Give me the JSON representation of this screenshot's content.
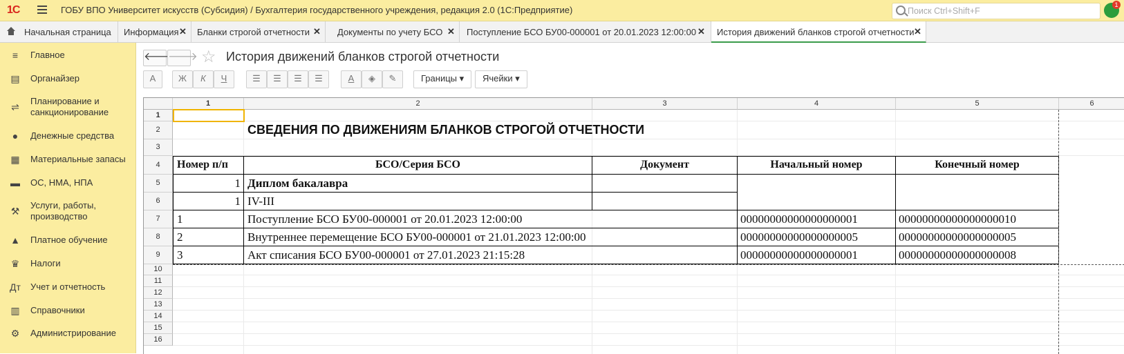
{
  "app": {
    "logo": "1С",
    "title": "ГОБУ ВПО Университет искусств (Субсидия) / Бухгалтерия государственного учреждения, редакция 2.0  (1С:Предприятие)",
    "search_placeholder": "Поиск Ctrl+Shift+F",
    "notifications": "1"
  },
  "tabs": [
    {
      "label": "Начальная страница"
    },
    {
      "label": "Информация"
    },
    {
      "label": "Бланки строгой отчетности"
    },
    {
      "label": "Документы по учету БСО"
    },
    {
      "label": "Поступление БСО БУ00-000001 от 20.01.2023 12:00:00"
    },
    {
      "label": "История движений бланков строгой отчетности"
    }
  ],
  "sidebar": {
    "items": [
      {
        "label": "Главное",
        "icon": "menu-list-icon"
      },
      {
        "label": "Органайзер",
        "icon": "organizer-icon"
      },
      {
        "label": "Планирование и",
        "label2": "санкционирование",
        "icon": "planning-icon"
      },
      {
        "label": "Денежные средства",
        "icon": "money-icon"
      },
      {
        "label": "Материальные запасы",
        "icon": "inventory-icon"
      },
      {
        "label": "ОС, НМА, НПА",
        "icon": "truck-icon"
      },
      {
        "label": "Услуги, работы,",
        "label2": "производство",
        "icon": "services-icon"
      },
      {
        "label": "Платное обучение",
        "icon": "graduation-icon"
      },
      {
        "label": "Налоги",
        "icon": "eagle-icon"
      },
      {
        "label": "Учет и отчетность",
        "icon": "accounting-icon"
      },
      {
        "label": "Справочники",
        "icon": "book-icon"
      },
      {
        "label": "Администрирование",
        "icon": "gear-icon"
      }
    ]
  },
  "page": {
    "title": "История движений бланков строгой отчетности",
    "toolbar": {
      "font_btn": "A",
      "bold": "Ж",
      "italic": "К",
      "underline": "Ч",
      "borders": "Границы",
      "cells": "Ячейки"
    }
  },
  "sheet": {
    "col_headers": [
      "1",
      "2",
      "3",
      "4",
      "5",
      "6"
    ],
    "row_headers": [
      "1",
      "2",
      "3",
      "4",
      "5",
      "6",
      "7",
      "8",
      "9",
      "10",
      "11",
      "12",
      "13",
      "14",
      "15",
      "16"
    ],
    "report_title": "СВЕДЕНИЯ ПО ДВИЖЕНИЯМ БЛАНКОВ СТРОГОЙ ОТЧЕТНОСТИ",
    "headers": {
      "num": "Номер п/п",
      "bso": "БСО/Серия БСО",
      "doc": "Документ",
      "start": "Начальный номер",
      "end": "Конечный номер"
    },
    "group": {
      "num": "1",
      "name": "Диплом бакалавра"
    },
    "series": {
      "num": "1",
      "name": "IV-III"
    },
    "rows": [
      {
        "num": "1",
        "doc": "Поступление БСО БУ00-000001 от 20.01.2023 12:00:00",
        "start": "00000000000000000001",
        "end": "00000000000000000010"
      },
      {
        "num": "2",
        "doc": "Внутреннее перемещение БСО БУ00-000001 от 21.01.2023 12:00:00",
        "start": "00000000000000000005",
        "end": "00000000000000000005"
      },
      {
        "num": "3",
        "doc": "Акт списания БСО БУ00-000001 от 27.01.2023 21:15:28",
        "start": "00000000000000000001",
        "end": "00000000000000000008"
      }
    ]
  }
}
